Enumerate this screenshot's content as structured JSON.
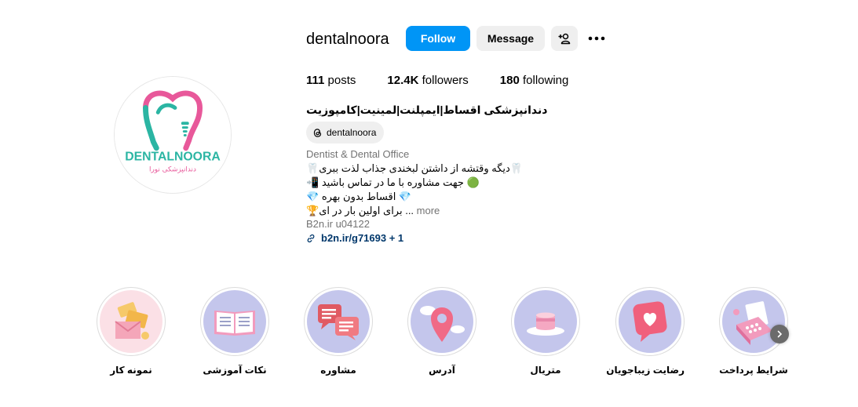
{
  "profile": {
    "username": "dentalnoora",
    "full_name": "دندانپزشکی اقساط|ایمپلنت|لمینیت|کامپوزیت",
    "threads_handle": "dentalnoora",
    "category": "Dentist & Dental Office",
    "bio_lines": [
      "🦷دیگه وقتشه از داشتن لبخندی جذاب لذت ببری🦷",
      "📲 جهت مشاوره با ما در تماس باشید 🟢",
      "💎 اقساط بدون بهره 💎"
    ],
    "bio_line_last": "🏆برای اولین بار در ای ...",
    "more_label": "more",
    "meta_id": "B2n.ir u04122",
    "link_text": "b2n.ir/g71693 + 1",
    "logo_text_top": "DENTALNOORA",
    "logo_text_bottom": "دندانپزشکی نورا"
  },
  "actions": {
    "follow_label": "Follow",
    "message_label": "Message",
    "suggest_icon": "person-add-icon",
    "more_icon": "more-options-icon"
  },
  "stats": {
    "posts_count": "111",
    "posts_label": "posts",
    "followers_count": "12.4K",
    "followers_label": "followers",
    "following_count": "180",
    "following_label": "following"
  },
  "highlights": [
    {
      "label": "شرایط پرداخت",
      "icon": "calculator-icon"
    },
    {
      "label": "رضایت زیباجویان",
      "icon": "heart-message-icon"
    },
    {
      "label": "متریال",
      "icon": "cream-jar-icon"
    },
    {
      "label": "آدرس",
      "icon": "location-pin-icon"
    },
    {
      "label": "مشاوره",
      "icon": "chat-bubbles-icon"
    },
    {
      "label": "نکات آموزشی",
      "icon": "open-book-icon"
    },
    {
      "label": "نمونه کار",
      "icon": "envelope-icon"
    }
  ],
  "colors": {
    "accent": "#0095f6",
    "button_secondary": "#efefef",
    "link": "#00376b",
    "muted": "#737373",
    "logo_pink": "#e8589a",
    "logo_teal": "#2bb5a3"
  }
}
